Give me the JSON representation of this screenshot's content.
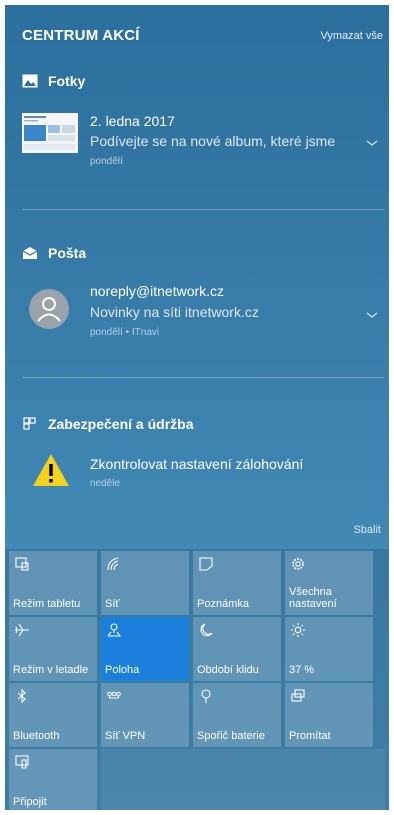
{
  "header": {
    "title": "CENTRUM AKCÍ",
    "clear_all": "Vymazat vše"
  },
  "groups": [
    {
      "app": "Fotky",
      "notification": {
        "title": "2. ledna 2017",
        "body": "Podívejte se na nové album, které jsme",
        "meta": "pondělí"
      }
    },
    {
      "app": "Pošta",
      "notification": {
        "title": "noreply@itnetwork.cz",
        "body": "Novinky na síti itnetwork.cz",
        "meta": "pondělí • ITnavi"
      }
    },
    {
      "app": "Zabezpečení a údržba",
      "notification": {
        "title": "Zkontrolovat nastavení zálohování",
        "meta": "neděle"
      }
    }
  ],
  "collapse_label": "Sbalit",
  "quick_actions": [
    {
      "label": "Režim tabletu",
      "icon": "tablet-mode-icon",
      "active": false
    },
    {
      "label": "Síť",
      "icon": "network-icon",
      "active": false
    },
    {
      "label": "Poznámka",
      "icon": "note-icon",
      "active": false
    },
    {
      "label": "Všechna nastavení",
      "icon": "settings-gear-icon",
      "active": false
    },
    {
      "label": "Režim v letadle",
      "icon": "airplane-icon",
      "active": false
    },
    {
      "label": "Poloha",
      "icon": "location-icon",
      "active": true
    },
    {
      "label": "Období klidu",
      "icon": "moon-icon",
      "active": false
    },
    {
      "label": "37 %",
      "icon": "brightness-icon",
      "active": false
    },
    {
      "label": "Bluetooth",
      "icon": "bluetooth-icon",
      "active": false
    },
    {
      "label": "Síť VPN",
      "icon": "vpn-icon",
      "active": false
    },
    {
      "label": "Spořič baterie",
      "icon": "battery-saver-icon",
      "active": false
    },
    {
      "label": "Promítat",
      "icon": "project-icon",
      "active": false
    },
    {
      "label": "Připojit",
      "icon": "connect-icon",
      "active": false
    }
  ],
  "colors": {
    "accent": "#1a80dc",
    "warning": "#f2d21c"
  }
}
